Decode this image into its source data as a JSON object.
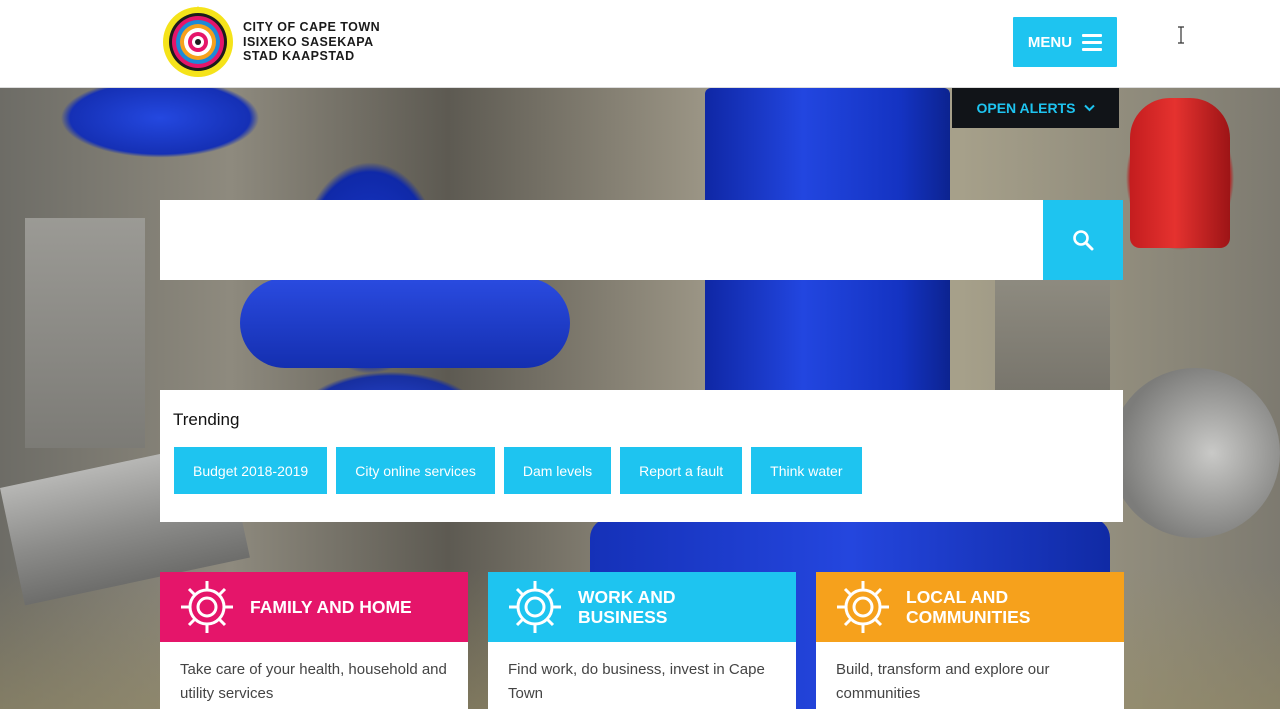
{
  "header": {
    "logo_lines": [
      "CITY OF CAPE TOWN",
      "ISIXEKO SASEKAPA",
      "STAD KAAPSTAD"
    ],
    "menu_label": "MENU"
  },
  "alerts": {
    "label": "OPEN ALERTS"
  },
  "search": {
    "value": "",
    "placeholder": ""
  },
  "trending": {
    "title": "Trending",
    "items": [
      "Budget 2018-2019",
      "City online services",
      "Dam levels",
      "Report a fault",
      "Think water"
    ]
  },
  "cards": [
    {
      "title": "FAMILY AND HOME",
      "description": "Take care of your health, household and utility services",
      "color": "#e5156a"
    },
    {
      "title": "WORK AND BUSINESS",
      "description": "Find work, do business, invest in Cape Town",
      "color": "#1ec4f0"
    },
    {
      "title": "LOCAL AND COMMUNITIES",
      "description": "Build, transform and explore our communities",
      "color": "#f6a11c"
    }
  ],
  "colors": {
    "accent": "#1ec4f0",
    "alerts_bg": "#111418"
  },
  "icons": [
    "city-logo",
    "hamburger-icon",
    "chevron-down-icon",
    "search-icon",
    "gear-icon"
  ]
}
